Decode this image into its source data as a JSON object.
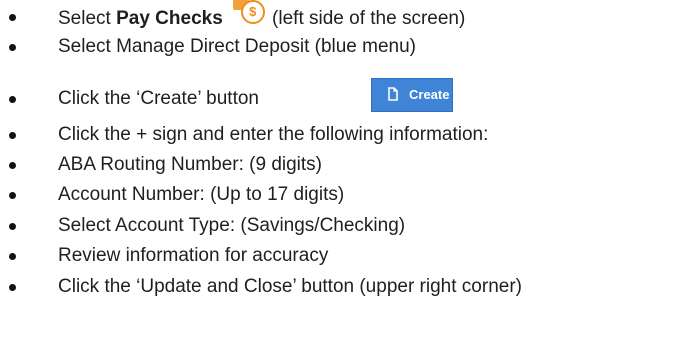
{
  "steps": [
    {
      "pre": "Select ",
      "bold": "Pay Checks",
      "post": " (left side of the screen)",
      "icon": "pay-checks-icon"
    },
    {
      "text": "Select Manage Direct Deposit (blue menu)"
    },
    {
      "text": "Click the ‘Create’ button",
      "button_label": "Create",
      "button_icon": "create-document-icon"
    },
    {
      "text": "Click the + sign and enter the following information:"
    },
    {
      "text": "ABA Routing Number: (9 digits)"
    },
    {
      "text": "Account Number: (Up to 17 digits)"
    },
    {
      "text": "Select Account Type: (Savings/Checking)"
    },
    {
      "text": "Review information for accuracy"
    },
    {
      "text": "Click the ‘Update and Close’ button (upper right corner)"
    }
  ],
  "colors": {
    "icon_orange": "#f28c1d",
    "button_blue": "#3f84d6"
  }
}
